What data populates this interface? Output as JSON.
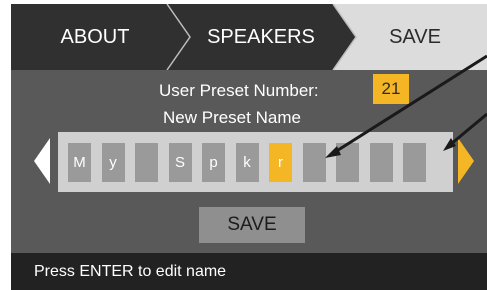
{
  "tabs": [
    {
      "label": "ABOUT",
      "active": false
    },
    {
      "label": "SPEAKERS",
      "active": false
    },
    {
      "label": "SAVE",
      "active": true
    }
  ],
  "preset": {
    "number_label": "User Preset Number:",
    "number_value": "21",
    "name_label": "New Preset Name",
    "slots": [
      "M",
      "y",
      "",
      "S",
      "p",
      "k",
      "r",
      "",
      "",
      "",
      ""
    ],
    "cursor_index": 6
  },
  "icons": {
    "left": "triangle-left-icon",
    "right": "triangle-right-icon"
  },
  "save_label": "SAVE",
  "status_text": "Press ENTER to edit name",
  "colors": {
    "background": "#595959",
    "accent": "#f5b625",
    "slot": "#9a9a9a",
    "name_box": "#d0d0d0",
    "tab_bar": "#303030",
    "active_tab": "#dcdcdc",
    "status_bar": "#222222"
  }
}
